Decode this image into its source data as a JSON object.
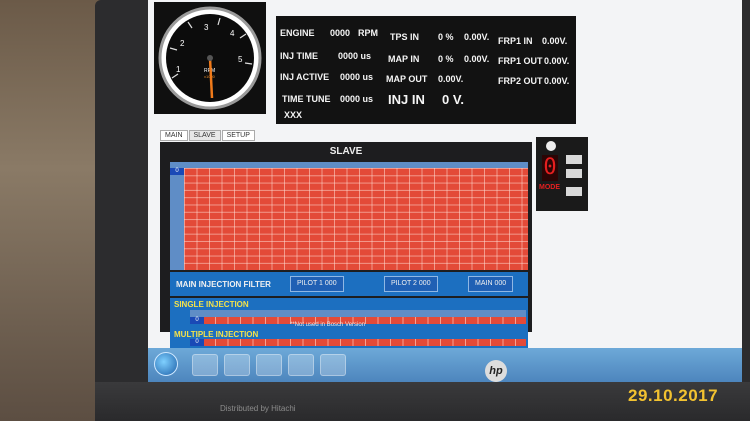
{
  "tabs": [
    {
      "label": "MAIN"
    },
    {
      "label": "SLAVE"
    },
    {
      "label": "SETUP"
    }
  ],
  "gauge": {
    "ticks": [
      "1",
      "2",
      "3",
      "4",
      "5"
    ],
    "label": "RPM",
    "sublabel": "x1000",
    "needle_value": 0
  },
  "readout": {
    "engine_label": "ENGINE",
    "engine_value": "0000",
    "engine_unit": "RPM",
    "tps_label": "TPS IN",
    "tps_pct": "0 %",
    "tps_volt": "0.00V.",
    "frp1_in_label": "FRP1 IN",
    "frp1_in_value": "0.00V.",
    "inj_time_label": "INJ TIME",
    "inj_time_value": "0000 us",
    "map_in_label": "MAP IN",
    "map_in_pct": "0 %",
    "map_in_volt": "0.00V.",
    "frp1_out_label": "FRP1 OUT",
    "frp1_out_value": "0.00V.",
    "inj_active_label": "INJ ACTIVE",
    "inj_active_value": "0000 us",
    "map_out_label": "MAP OUT",
    "map_out_value": "0.00V.",
    "frp2_out_label": "FRP2 OUT",
    "frp2_out_value": "0.00V.",
    "time_tune_label": "TIME TUNE",
    "time_tune_value": "0000 us",
    "inj_in_label": "INJ IN",
    "inj_in_value": "0 V.",
    "xxx": "XXX"
  },
  "slave": {
    "title": "SLAVE",
    "corner_value": "0",
    "main_injection_filter": "MAIN INJECTION FILTER",
    "pilot1_label": "PILOT 1",
    "pilot1_value": "000",
    "pilot2_label": "PILOT 2",
    "pilot2_value": "000",
    "main_label": "MAIN",
    "main_value": "000",
    "single_injection": "SINGLE INJECTION",
    "single_note": "**Not used in Bosch Version",
    "single_value": "0",
    "multiple_injection": "MULTIPLE INJECTION",
    "multiple_value": "0"
  },
  "mode": {
    "digit": "0",
    "label": "MODE"
  },
  "laptop": {
    "logo": "hp",
    "brand": "Distributed by Hitachi"
  },
  "datestamp": "29.10.2017",
  "colors": {
    "cell_red": "#e34a38",
    "panel_blue": "#1c6fc0",
    "title_yellow": "#f4e24a",
    "mode_red": "#e51f1f"
  }
}
